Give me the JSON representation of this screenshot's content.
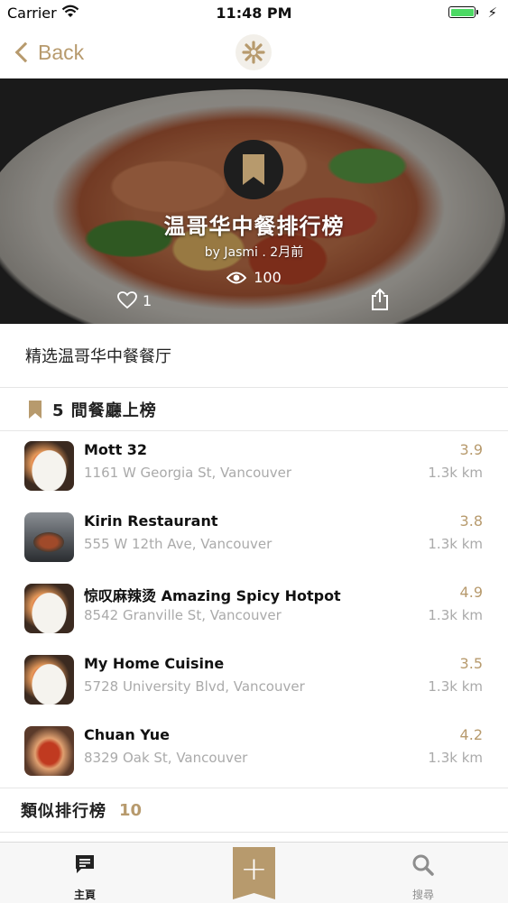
{
  "status_bar": {
    "carrier": "Carrier",
    "time": "11:48 PM"
  },
  "nav": {
    "back_label": "Back"
  },
  "hero": {
    "title": "温哥华中餐排行榜",
    "byline": "by Jasmi . 2月前",
    "views": "100",
    "likes": "1"
  },
  "description": "精选温哥华中餐餐厅",
  "section": {
    "title": "5 間餐廳上榜"
  },
  "restaurants": [
    {
      "name": "Mott 32",
      "address": "1161 W Georgia St, Vancouver",
      "score": "3.9",
      "distance": "1.3k km"
    },
    {
      "name": "Kirin Restaurant",
      "address": "555 W 12th Ave, Vancouver",
      "score": "3.8",
      "distance": "1.3k km"
    },
    {
      "name": "惊叹麻辣烫 Amazing Spicy Hotpot",
      "address": "8542 Granville St, Vancouver",
      "score": "4.9",
      "distance": "1.3k km"
    },
    {
      "name": "My Home Cuisine",
      "address": "5728 University Blvd, Vancouver",
      "score": "3.5",
      "distance": "1.3k km"
    },
    {
      "name": "Chuan Yue",
      "address": "8329 Oak St, Vancouver",
      "score": "4.2",
      "distance": "1.3k km"
    }
  ],
  "similar": {
    "title": "類似排行榜",
    "count": "10"
  },
  "tabbar": {
    "home_label": "主頁",
    "search_label": "搜尋",
    "add_symbol": "+"
  },
  "colors": {
    "accent": "#b79a6d",
    "muted": "#aaaaaa"
  },
  "icons": [
    "wifi-icon",
    "battery-icon",
    "bolt-icon",
    "back-chevron-icon",
    "logo-icon",
    "bookmark-icon",
    "eye-icon",
    "heart-icon",
    "share-icon",
    "chat-icon",
    "plus-icon",
    "search-icon"
  ]
}
